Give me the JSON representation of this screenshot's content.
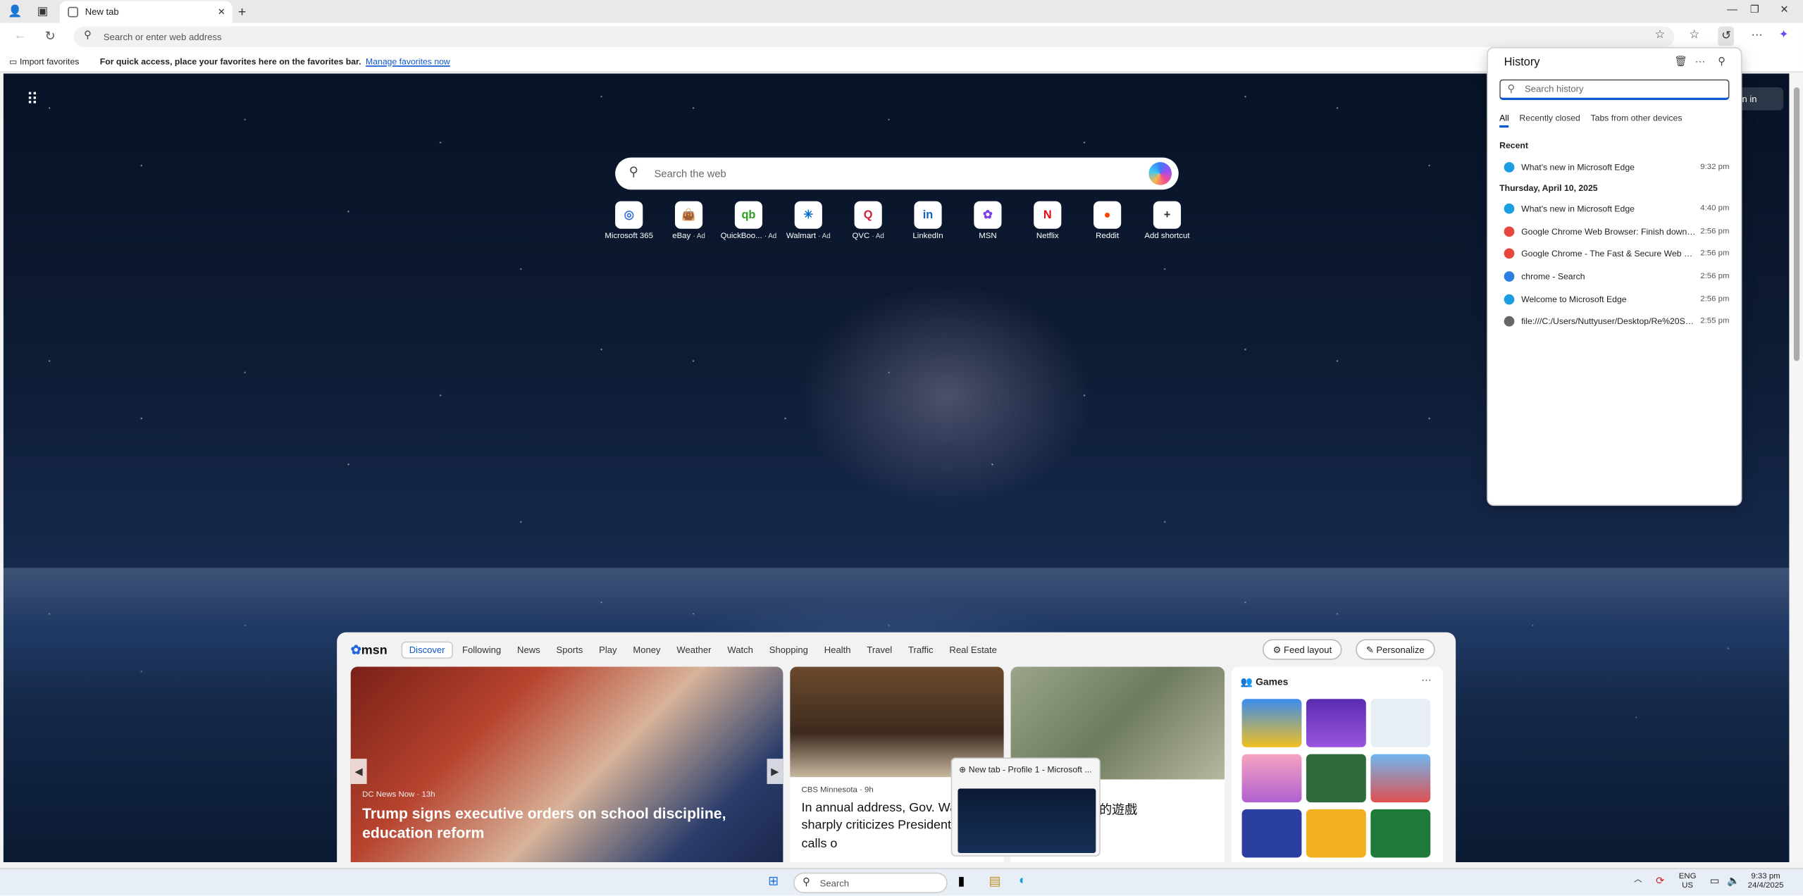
{
  "tab": {
    "title": "New tab"
  },
  "address": {
    "placeholder": "Search or enter web address"
  },
  "favbar": {
    "import": "Import favorites",
    "message": "For quick access, place your favorites here on the favorites bar.",
    "link": "Manage favorites now"
  },
  "newtab": {
    "search_placeholder": "Search the web",
    "signin": "n in",
    "shortcuts": [
      {
        "label": "Microsoft 365",
        "ad": "",
        "glyph": "◎",
        "color": "#3b6fd8"
      },
      {
        "label": "eBay",
        "ad": "· Ad",
        "glyph": "👜",
        "color": "#e5322d"
      },
      {
        "label": "QuickBoo...",
        "ad": "· Ad",
        "glyph": "qb",
        "color": "#2ca01c"
      },
      {
        "label": "Walmart",
        "ad": "· Ad",
        "glyph": "✳",
        "color": "#0071ce"
      },
      {
        "label": "QVC",
        "ad": "· Ad",
        "glyph": "Q",
        "color": "#c23"
      },
      {
        "label": "LinkedIn",
        "ad": "",
        "glyph": "in",
        "color": "#0a66c2"
      },
      {
        "label": "MSN",
        "ad": "",
        "glyph": "✿",
        "color": "#7b3fe4"
      },
      {
        "label": "Netflix",
        "ad": "",
        "glyph": "N",
        "color": "#e50914"
      },
      {
        "label": "Reddit",
        "ad": "",
        "glyph": "●",
        "color": "#ff4500"
      },
      {
        "label": "Add shortcut",
        "ad": "",
        "glyph": "+",
        "color": "#333"
      }
    ]
  },
  "feed": {
    "logo": "msn",
    "tabs": [
      "Discover",
      "Following",
      "News",
      "Sports",
      "Play",
      "Money",
      "Weather",
      "Watch",
      "Shopping",
      "Health",
      "Travel",
      "Traffic",
      "Real Estate"
    ],
    "feed_layout": "Feed layout",
    "personalize": "Personalize",
    "hero": {
      "source": "DC News Now · 13h",
      "title": "Trump signs executive orders on school discipline, education reform"
    },
    "card2": {
      "source": "CBS Minnesota · 9h",
      "title": "In annual address, Gov. Walz sharply criticizes President Trump, calls o"
    },
    "card3": {
      "title": "玩的遊戲"
    },
    "games": {
      "title": "Games"
    }
  },
  "preview": {
    "title": "New tab - Profile 1 - Microsoft ..."
  },
  "history": {
    "title": "History",
    "search_placeholder": "Search history",
    "tabs": [
      "All",
      "Recently closed",
      "Tabs from other devices"
    ],
    "sections": [
      {
        "heading": "Recent",
        "items": [
          {
            "title": "What's new in Microsoft Edge",
            "time": "9:32 pm",
            "icon": "edge-icon",
            "color": "#1b9de2"
          }
        ]
      },
      {
        "heading": "Thursday, April 10, 2025",
        "items": [
          {
            "title": "What's new in Microsoft Edge",
            "time": "4:40 pm",
            "icon": "edge-icon",
            "color": "#1b9de2"
          },
          {
            "title": "Google Chrome Web Browser: Finish downloa...",
            "time": "2:56 pm",
            "icon": "chrome-icon",
            "color": "#e8453c"
          },
          {
            "title": "Google Chrome - The Fast & Secure Web Bro...",
            "time": "2:56 pm",
            "icon": "chrome-icon",
            "color": "#e8453c"
          },
          {
            "title": "chrome - Search",
            "time": "2:56 pm",
            "icon": "bing-icon",
            "color": "#2a7de1"
          },
          {
            "title": "Welcome to Microsoft Edge",
            "time": "2:56 pm",
            "icon": "edge-icon",
            "color": "#1b9de2"
          },
          {
            "title": "file:///C:/Users/Nuttyuser/Desktop/Re%20Sp...",
            "time": "2:55 pm",
            "icon": "globe-icon",
            "color": "#666"
          }
        ]
      }
    ]
  },
  "taskbar": {
    "search": "Search",
    "lang": "ENG",
    "region": "US",
    "time": "9:33 pm",
    "date": "24/4/2025"
  }
}
